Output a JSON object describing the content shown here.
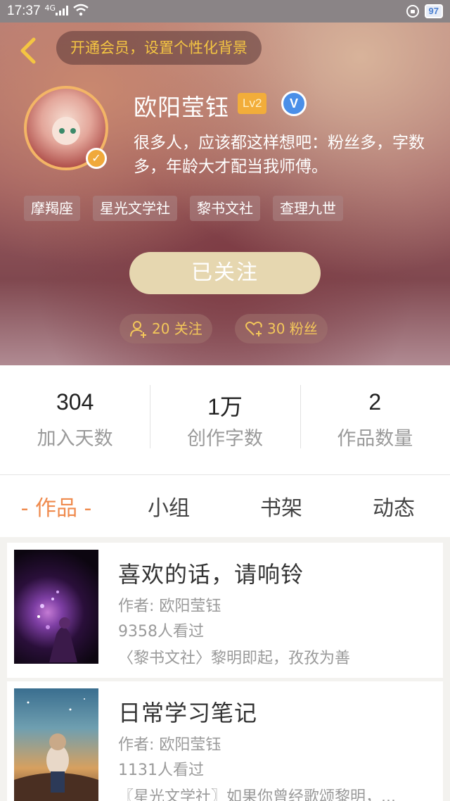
{
  "status_bar": {
    "time": "17:37",
    "signal": "4G",
    "battery": "97"
  },
  "header": {
    "vip_prompt": "开通会员，设置个性化背景"
  },
  "profile": {
    "name": "欧阳莹钰",
    "level": "Lv2",
    "verified_mark": "V",
    "bio": "很多人，应该都这样想吧：粉丝多，字数多，年龄大才配当我师傅。",
    "tags": [
      "摩羯座",
      "星光文学社",
      "黎书文社",
      "查理九世"
    ],
    "follow_label": "已关注",
    "following": "20 关注",
    "fans": "30 粉丝"
  },
  "stats": [
    {
      "value": "304",
      "label": "加入天数"
    },
    {
      "value": "1万",
      "label": "创作字数"
    },
    {
      "value": "2",
      "label": "作品数量"
    }
  ],
  "tabs": [
    {
      "label": "- 作品 -",
      "active": true
    },
    {
      "label": "小组",
      "active": false
    },
    {
      "label": "书架",
      "active": false
    },
    {
      "label": "动态",
      "active": false
    }
  ],
  "works": [
    {
      "title": "喜欢的话，请响铃",
      "author": "作者: 欧阳莹钰",
      "views": "9358人看过",
      "desc": "〈黎书文社〉黎明即起，孜孜为善"
    },
    {
      "title": "日常学习笔记",
      "author": "作者: 欧阳莹钰",
      "views": "1131人看过",
      "desc": "〖星光文学社〗如果你曾经歌颂黎明，..."
    }
  ],
  "colors": {
    "accent": "#ef8a4d",
    "gold": "#f4c542",
    "follow_button": "#e6d7b0"
  }
}
